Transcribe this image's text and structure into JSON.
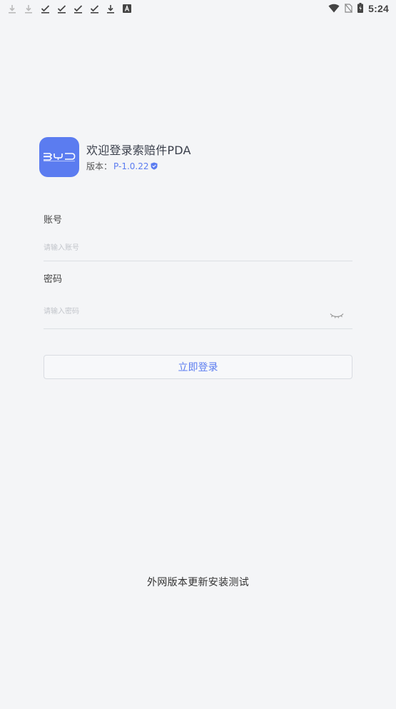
{
  "status_bar": {
    "time": "5:24",
    "notification_icons": [
      "download-icon",
      "download-icon",
      "check-icon",
      "check-icon",
      "check-icon",
      "check-icon",
      "download-icon",
      "app-a-icon"
    ],
    "system_icons": [
      "wifi-icon",
      "no-sim-icon",
      "battery-charging-icon"
    ]
  },
  "header": {
    "logo_alt": "BYD",
    "welcome_title": "欢迎登录索赔件PDA",
    "version_label": "版本：",
    "version_value": "P-1.0.22"
  },
  "form": {
    "account_label": "账号",
    "account_placeholder": "请输入账号",
    "password_label": "密码",
    "password_placeholder": "请输入密码"
  },
  "login_button_label": "立即登录",
  "footer_note": "外网版本更新安装测试",
  "colors": {
    "accent": "#5b7cf0",
    "background": "#f4f5f7"
  }
}
